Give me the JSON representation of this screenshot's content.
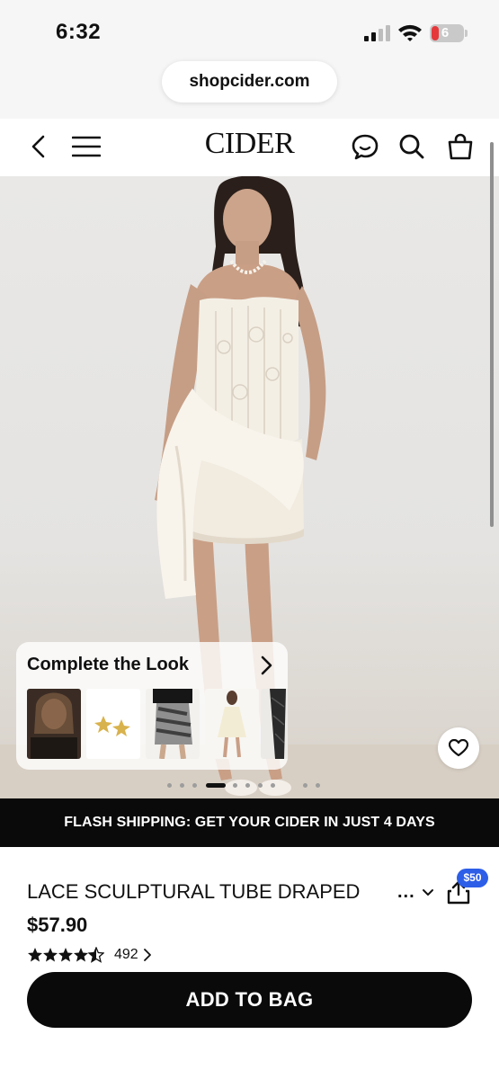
{
  "status_bar": {
    "time": "6:32",
    "battery_level": "6",
    "icons": [
      "signal-icon",
      "wifi-icon",
      "battery-icon"
    ]
  },
  "browser": {
    "url": "shopcider.com"
  },
  "header": {
    "logo": "CIDER",
    "icons": [
      "back-icon",
      "menu-icon",
      "chat-icon",
      "search-icon",
      "bag-icon"
    ]
  },
  "hero": {
    "complete_the_look": {
      "title": "Complete the Look",
      "thumbnail_count": 5
    },
    "image_index": 4,
    "image_count": 10
  },
  "banner": {
    "text": "FLASH SHIPPING: GET YOUR CIDER IN JUST 4 DAYS"
  },
  "product": {
    "title": "LACE SCULPTURAL TUBE DRAPED",
    "more_label": "...",
    "share_badge": "$50",
    "price": "$57.90",
    "rating": 4.5,
    "review_count": "492"
  },
  "actions": {
    "add_to_bag": "ADD TO BAG"
  },
  "colors": {
    "brand_black": "#0a0a0a",
    "badge_blue": "#2d5ee8",
    "background": "#ffffff"
  }
}
